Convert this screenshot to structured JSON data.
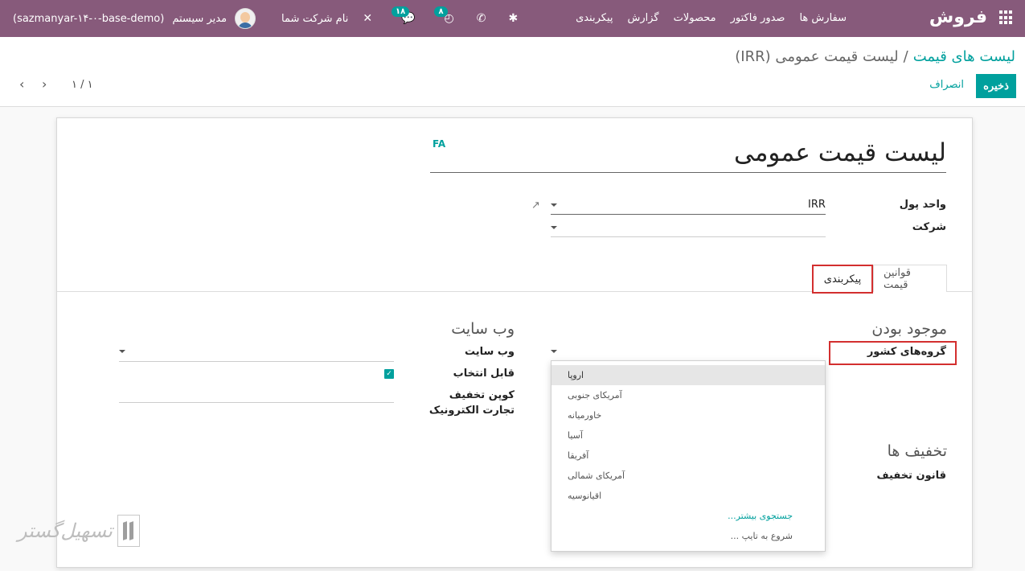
{
  "navbar": {
    "brand": "فروش",
    "menu": [
      "سفارش ها",
      "صدور فاکتور",
      "محصولات",
      "گزارش",
      "پیکربندی"
    ],
    "database": "(sazmanyar-۱۴-۰-base-demo)",
    "user": "مدیر سیستم",
    "company": "نام شرکت شما",
    "activity_count": "۸",
    "message_count": "۱۸",
    "accent_color": "#875a7b"
  },
  "control_panel": {
    "breadcrumb_parent": "لیست های قیمت",
    "breadcrumb_separator": "/",
    "breadcrumb_current": "لیست قیمت عمومی (IRR)",
    "save_label": "ذخیره",
    "discard_label": "انصراف",
    "pager_value": "۱ / ۱",
    "pager_prev": "‹",
    "pager_next": "›"
  },
  "form": {
    "lang_badge": "FA",
    "title": "لیست قیمت عمومی",
    "currency_label": "واحد پول",
    "currency_value": "IRR",
    "company_label": "شرکت",
    "company_value": "",
    "tabs": [
      {
        "label": "قوانین قیمت",
        "active": false
      },
      {
        "label": "پیکربندی",
        "active": true
      }
    ],
    "availability_title": "موجود بودن",
    "country_groups_label": "گروه‌های کشور",
    "website_title": "وب سایت",
    "website_label": "وب سایت",
    "selectable_label": "قابل انتخاب",
    "selectable_checked": true,
    "ecommerce_coupon_label": "کوپن تخفیف تجارت الکترونیک",
    "discounts_title": "تخفیف ها",
    "discount_policy_label": "قانون تخفیف"
  },
  "dropdown": {
    "items": [
      "اروپا",
      "آمریکای جنوبی",
      "خاورمیانه",
      "آسیا",
      "آفریقا",
      "آمریکای شمالی",
      "اقیانوسیه"
    ],
    "active_index": 0,
    "search_more": "جستجوی بیشتر...",
    "start_typing": "شروع به تایپ ..."
  },
  "watermark": {
    "text": "تسهیل‌گستر"
  }
}
